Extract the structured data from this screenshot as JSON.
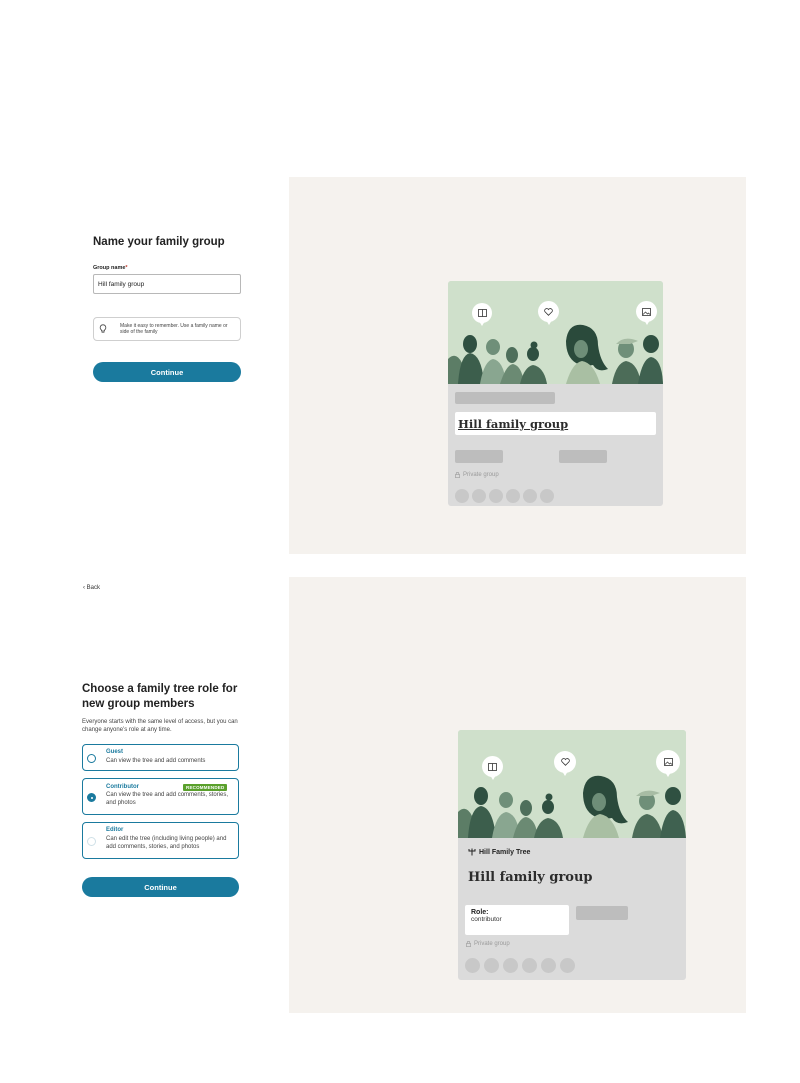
{
  "screen1": {
    "title": "Name your family group",
    "group_name_label": "Group name",
    "required_mark": "*",
    "group_name_value": "Hill family group",
    "tip_text": "Make it easy to remember. Use a family name or side of the family",
    "continue_label": "Continue",
    "preview": {
      "group_title": "Hill family group",
      "privacy": "Private group",
      "member_dots": 6
    }
  },
  "screen2": {
    "back_label": "Back",
    "title": "Choose a family tree role for new group members",
    "subtitle": "Everyone starts with the same level of access, but you can change anyone’s role at any time.",
    "options": [
      {
        "title": "Guest",
        "description": "Can view the tree and add comments",
        "selected": false
      },
      {
        "title": "Contributor",
        "badge": "RECOMMENDED",
        "description": "Can view the tree and add comments, stories, and photos",
        "selected": true
      },
      {
        "title": "Editor",
        "description": "Can edit the tree (including living people) and add comments, stories, and photos",
        "selected": false
      }
    ],
    "continue_label": "Continue",
    "preview": {
      "tree_name": "Hill Family Tree",
      "group_title": "Hill family group",
      "role_label": "Role:",
      "role_value": "contributor",
      "privacy": "Private group",
      "member_dots": 6
    }
  },
  "colors": {
    "primary": "#1a7a9e",
    "recommended_badge": "#5aa02c",
    "preview_background": "#f5f2ee",
    "card_background": "#dbdbdb",
    "illustration_background": "#cfe0cb"
  },
  "icons": [
    "lightbulb-icon",
    "book-icon",
    "heart-icon",
    "image-icon",
    "tree-icon",
    "lock-icon",
    "chevron-left-icon"
  ]
}
